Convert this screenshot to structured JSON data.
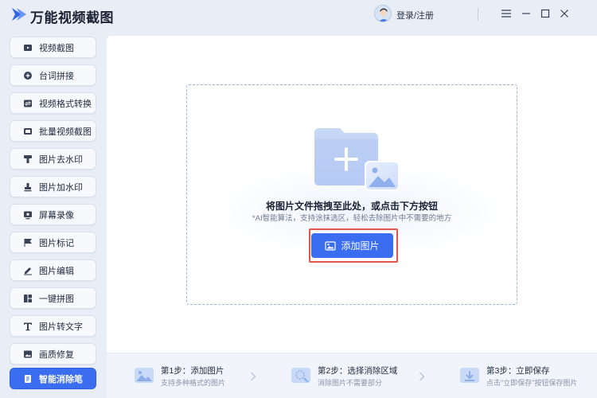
{
  "app": {
    "title": "万能视频截图"
  },
  "header": {
    "login_label": "登录/注册"
  },
  "sidebar": {
    "items": [
      {
        "label": "视频截图",
        "icon": "video-capture-icon"
      },
      {
        "label": "台词拼接",
        "icon": "subtitle-join-icon"
      },
      {
        "label": "视频格式转换",
        "icon": "video-convert-icon"
      },
      {
        "label": "批量视频截图",
        "icon": "batch-capture-icon"
      },
      {
        "label": "图片去水印",
        "icon": "remove-watermark-icon"
      },
      {
        "label": "图片加水印",
        "icon": "add-watermark-icon"
      },
      {
        "label": "屏幕录像",
        "icon": "screen-record-icon"
      },
      {
        "label": "图片标记",
        "icon": "image-mark-icon"
      },
      {
        "label": "图片编辑",
        "icon": "image-edit-icon"
      },
      {
        "label": "一键拼图",
        "icon": "collage-icon"
      },
      {
        "label": "图片转文字",
        "icon": "image-to-text-icon"
      },
      {
        "label": "画质修复",
        "icon": "quality-repair-icon"
      },
      {
        "label": "智能消除笔",
        "icon": "smart-eraser-icon",
        "active": true
      }
    ]
  },
  "main": {
    "drop_title": "将图片文件拖拽至此处，或点击下方按钮",
    "drop_subtitle": "*AI智能算法，支持涂抹选区，轻松去除图片中不需要的地方",
    "add_button_label": "添加图片"
  },
  "steps": [
    {
      "title": "第1步：添加图片",
      "desc": "支持多种格式的图片"
    },
    {
      "title": "第2步：选择消除区域",
      "desc": "消除图片不需要部分"
    },
    {
      "title": "第3步：立即保存",
      "desc": "点击\"立即保存\"按钮保存图片"
    }
  ],
  "colors": {
    "accent": "#3a6df0",
    "highlight": "#e2574c",
    "background": "#e9eef6"
  }
}
